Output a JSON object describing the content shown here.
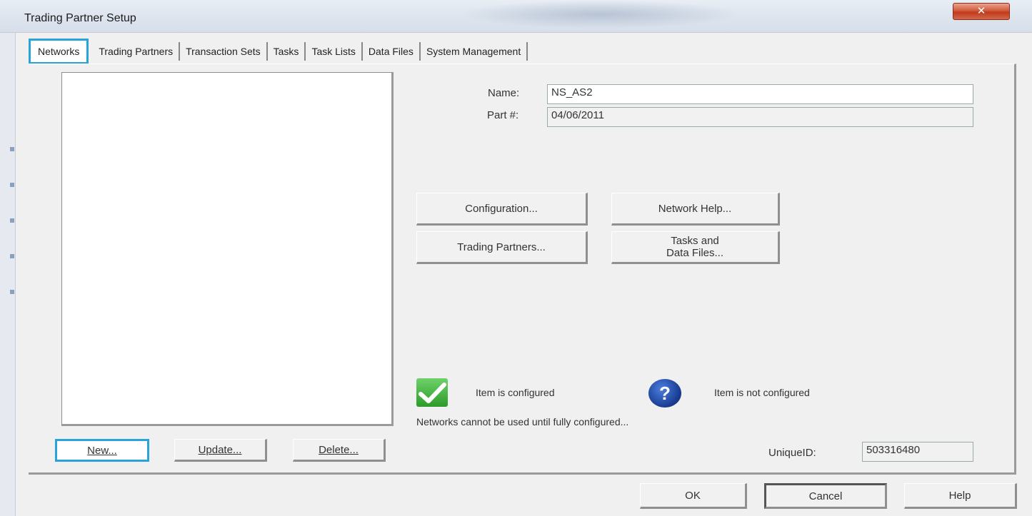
{
  "window": {
    "title": "Trading Partner Setup",
    "close_label": "✕"
  },
  "tabs": [
    {
      "label": "Networks"
    },
    {
      "label": "Trading Partners"
    },
    {
      "label": "Transaction Sets"
    },
    {
      "label": "Tasks"
    },
    {
      "label": "Task Lists"
    },
    {
      "label": "Data Files"
    },
    {
      "label": "System Management"
    }
  ],
  "form": {
    "name_label": "Name:",
    "name_value": "NS_AS2",
    "part_label": "Part #:",
    "part_value": "04/06/2011"
  },
  "actions": {
    "configuration": "Configuration...",
    "network_help": "Network Help...",
    "trading_partners": "Trading Partners...",
    "tasks_data_files_line1": "Tasks and",
    "tasks_data_files_line2": "Data Files..."
  },
  "legend": {
    "configured": "Item is configured",
    "not_configured": "Item is not configured",
    "note": "Networks cannot be used until fully configured..."
  },
  "list_buttons": {
    "new": "New...",
    "update": "Update...",
    "delete": "Delete..."
  },
  "unique_id": {
    "label": "UniqueID:",
    "value": "503316480"
  },
  "footer": {
    "ok": "OK",
    "cancel": "Cancel",
    "help": "Help"
  }
}
